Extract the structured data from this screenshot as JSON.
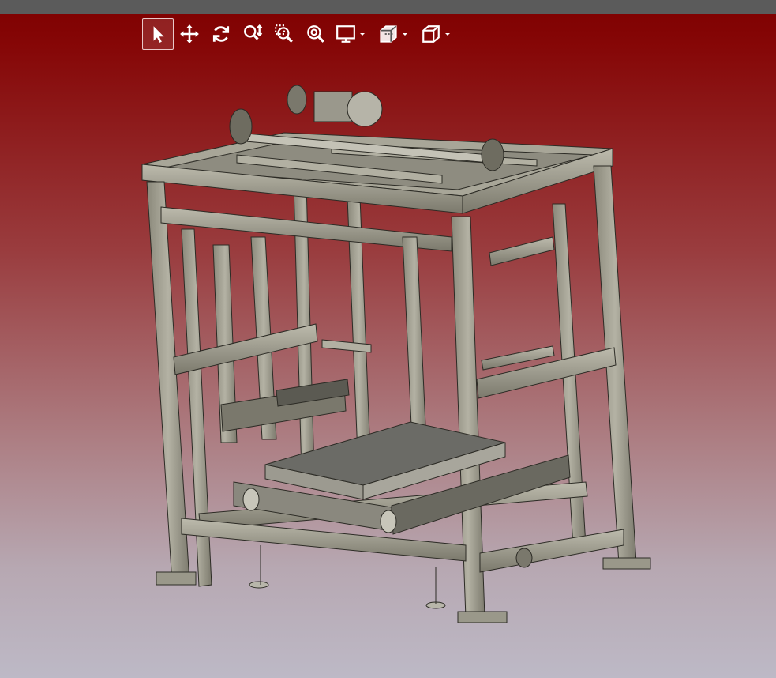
{
  "window": {
    "strip_color": "#5b5b5b"
  },
  "viewport": {
    "background_top": "#7e0000",
    "background_bottom": "#bdb9c6"
  },
  "toolbar": {
    "tools": [
      {
        "name": "select-tool",
        "icon": "arrow-pointer-icon",
        "active": true
      },
      {
        "name": "pan-tool",
        "icon": "move-arrows-icon",
        "active": false
      },
      {
        "name": "rotate-tool",
        "icon": "rotate-icon",
        "active": false
      },
      {
        "name": "zoom-tool",
        "icon": "zoom-updown-icon",
        "active": false
      },
      {
        "name": "zoom-window-tool",
        "icon": "zoom-box-icon",
        "active": false
      },
      {
        "name": "zoom-fit-tool",
        "icon": "zoom-fit-icon",
        "active": false
      },
      {
        "name": "display-mode-dropdown",
        "icon": "monitor-icon",
        "has_menu": true
      },
      {
        "name": "section-view-dropdown",
        "icon": "section-cube-icon",
        "has_menu": true
      },
      {
        "name": "standard-views-dropdown",
        "icon": "cube-view-icon",
        "has_menu": true
      }
    ]
  },
  "model": {
    "icon": "cad-frame-assembly",
    "frame_color": "#9a9888",
    "frame_dark": "#5f5d52",
    "platform_color": "#6b6b66"
  }
}
